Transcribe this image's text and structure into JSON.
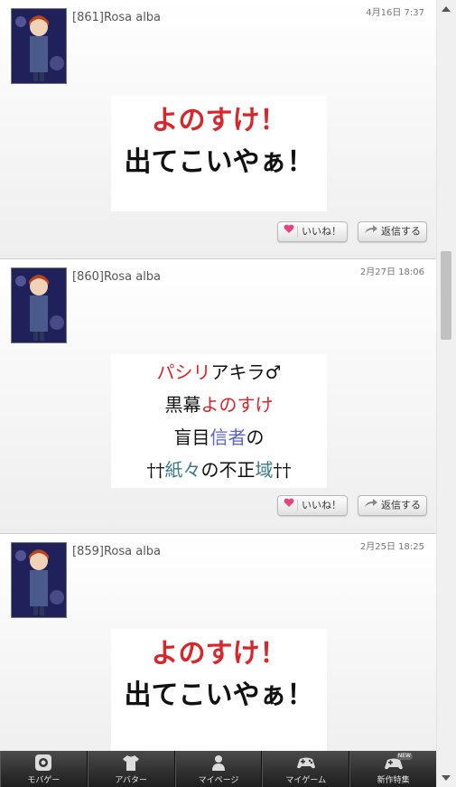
{
  "posts": [
    {
      "author": "[861]Rosa alba",
      "date": "4月16日 7:37",
      "image_lines": [
        "よのすけ！",
        "出てこいやぁ！"
      ],
      "like_label": "いいね！",
      "reply_label": "返信する"
    },
    {
      "author": "[860]Rosa alba",
      "date": "2月27日 18:06",
      "image_lines": [
        {
          "a": "パシリ",
          "b": "アキラ♂"
        },
        {
          "a": "黒幕",
          "b": "よのすけ"
        },
        {
          "a": "盲目",
          "b": "信者",
          "c": "の"
        },
        {
          "a": "††",
          "b": "紙々",
          "c": "の不正",
          "d": "域",
          "e": "††"
        }
      ],
      "like_label": "いいね！",
      "reply_label": "返信する"
    },
    {
      "author": "[859]Rosa alba",
      "date": "2月25日 18:25",
      "image_lines": [
        "よのすけ！",
        "出てこいやぁ！"
      ]
    }
  ],
  "tabbar": {
    "items": [
      {
        "label": "モバゲー",
        "icon": "mobage-icon"
      },
      {
        "label": "アバター",
        "icon": "tshirt-icon"
      },
      {
        "label": "マイページ",
        "icon": "person-icon"
      },
      {
        "label": "マイゲーム",
        "icon": "gamepad-icon"
      },
      {
        "label": "新作特集",
        "icon": "new-game-icon",
        "badge": "NEW"
      }
    ]
  },
  "colors": {
    "accent_red": "#d9262b",
    "blue_text": "#5b62c8",
    "teal_text": "#3a7a86",
    "tabbar_bg": "#2a2a2a"
  }
}
